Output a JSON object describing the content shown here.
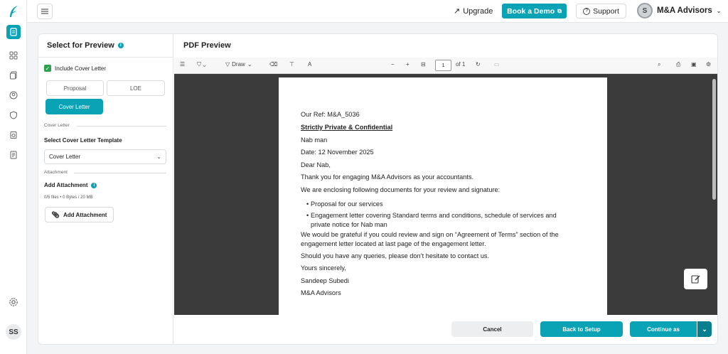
{
  "topbar": {
    "upgrade_label": "Upgrade",
    "demo_label": "Book a Demo",
    "support_label": "Support",
    "org_name": "M&A Advisors"
  },
  "user": {
    "initials": "SS"
  },
  "left_panel": {
    "title": "Select for Preview",
    "include_cover_label": "Include Cover Letter",
    "options": [
      "Proposal",
      "LOE",
      "Cover Letter"
    ],
    "cover_section_label": "Cover Letter",
    "template_label": "Select Cover Letter Template",
    "template_value": "Cover Letter",
    "attachment_section_label": "Attachment",
    "add_attachment_title": "Add Attachment",
    "files_info": "0/5 files • 0 Bytes / 20 MB",
    "add_attachment_button": "Add Attachment"
  },
  "preview": {
    "title": "PDF Preview",
    "toolbar": {
      "draw_label": "Draw",
      "page_number": "1",
      "page_count": "of 1"
    },
    "letter": {
      "ref": "Our Ref: M&A_5036",
      "private": "Strictly Private & Confidential",
      "name": "Nab man",
      "date": "Date: 12 November 2025",
      "greeting": "Dear Nab,",
      "thanks": "Thank you for engaging M&A Advisors as your accountants.",
      "enclosing": "We are enclosing following documents for your review and signature:",
      "bullet1": "Proposal for our services",
      "bullet2_line1": "Engagement letter covering Standard terms and conditions, schedule of services and",
      "bullet2_line2": "private notice for Nab man",
      "review_line1": "We would be grateful if you could review and sign on “Agreement of Terms” section of the",
      "review_line2": "engagement letter located at last page of the engagement letter.",
      "queries": "Should you have any queries, please don’t hesitate to contact us.",
      "closing": "Yours sincerely,",
      "signer": "Sandeep Subedi",
      "company": "M&A Advisors"
    }
  },
  "footer": {
    "cancel_label": "Cancel",
    "back_label": "Back to Setup",
    "continue_label": "Continue as"
  },
  "colors": {
    "accent": "#0aa3b5",
    "check": "#2e9e4f"
  }
}
